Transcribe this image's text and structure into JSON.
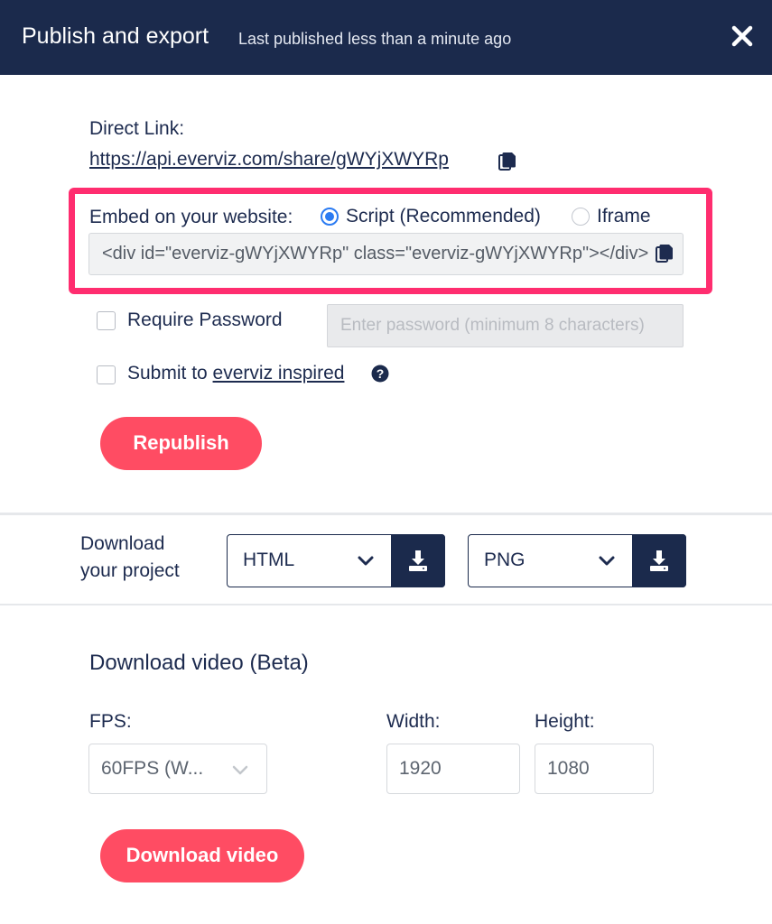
{
  "header": {
    "title": "Publish and export",
    "subtitle": "Last published less than a minute ago",
    "close_icon": "close-icon"
  },
  "direct_link": {
    "label": "Direct Link:",
    "url": "https://api.everviz.com/share/gWYjXWYRp",
    "copy_icon": "copy-icon"
  },
  "embed": {
    "label": "Embed on your website:",
    "options": [
      {
        "label": "Script (Recommended)",
        "selected": true
      },
      {
        "label": "Iframe",
        "selected": false
      }
    ],
    "code": "<div id=\"everviz-gWYjXWYRp\" class=\"everviz-gWYjXWYRp\"></div>",
    "highlight_color": "#ff2d6f"
  },
  "options": {
    "require_password": {
      "label": "Require Password",
      "checked": false
    },
    "password_placeholder": "Enter password (minimum 8 characters)",
    "submit_inspired": {
      "prefix": "Submit to ",
      "link": "everviz inspired",
      "checked": false,
      "help_icon": "question-circle-icon"
    }
  },
  "republish_label": "Republish",
  "download_project": {
    "label_line1": "Download",
    "label_line2": "your project",
    "format1": "HTML",
    "format2": "PNG",
    "download_icon": "download-icon"
  },
  "download_video": {
    "title": "Download video (Beta)",
    "fps_label": "FPS:",
    "fps_value": "60FPS (W...",
    "width_label": "Width:",
    "width_value": "1920",
    "height_label": "Height:",
    "height_value": "1080",
    "button_label": "Download video"
  },
  "colors": {
    "header_bg": "#1b2a4c",
    "accent": "#ff4c63",
    "radio_blue": "#2b7bf2"
  }
}
